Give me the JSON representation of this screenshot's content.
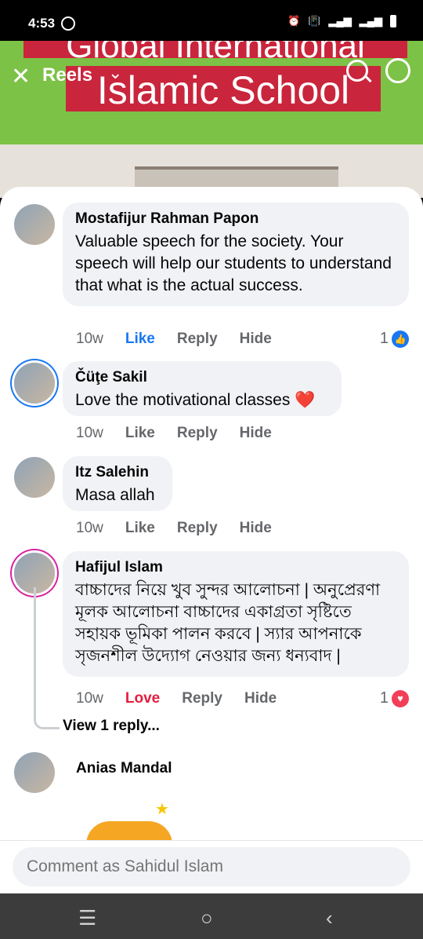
{
  "status": {
    "time": "4:53"
  },
  "video": {
    "banner_line1": "Global International",
    "banner_line2": "Islamic School",
    "reels_label": "Reels"
  },
  "comments": [
    {
      "author": "Mostafijur Rahman Papon",
      "text": "Valuable speech for the society. Your speech will help our students to understand that what is the actual success.",
      "time": "10w",
      "like": "Like",
      "reply": "Reply",
      "hide": "Hide",
      "reaction_count": "1",
      "reaction_type": "like",
      "like_active": true
    },
    {
      "author": "Čüţe Sakil",
      "text": "Love the motivational classes ❤️",
      "time": "10w",
      "like": "Like",
      "reply": "Reply",
      "hide": "Hide"
    },
    {
      "author": "Itz Salehin",
      "text": "Masa allah",
      "time": "10w",
      "like": "Like",
      "reply": "Reply",
      "hide": "Hide"
    },
    {
      "author": "Hafijul Islam",
      "text": "বাচ্চাদের নিয়ে খুব সুন্দর আলোচনা | অনুপ্রেরণা মূলক আলোচনা বাচ্চাদের একাগ্রতা সৃষ্টিতে সহায়ক ভূমিকা পালন করবে | স্যার আপনাকে সৃজনশীল উদ্যোগ নেওয়ার জন্য ধন্যবাদ |",
      "time": "10w",
      "like": "Love",
      "reply": "Reply",
      "hide": "Hide",
      "reaction_count": "1",
      "reaction_type": "love",
      "view_replies": "View 1 reply..."
    },
    {
      "author": "Anias Mandal"
    }
  ],
  "composer": {
    "placeholder": "Comment as Sahidul Islam"
  },
  "colors": {
    "accent": "#1877f2",
    "love": "#e41e3f",
    "bubble": "#f0f2f5",
    "video_bg": "#7cc246",
    "banner": "#c9253c"
  }
}
